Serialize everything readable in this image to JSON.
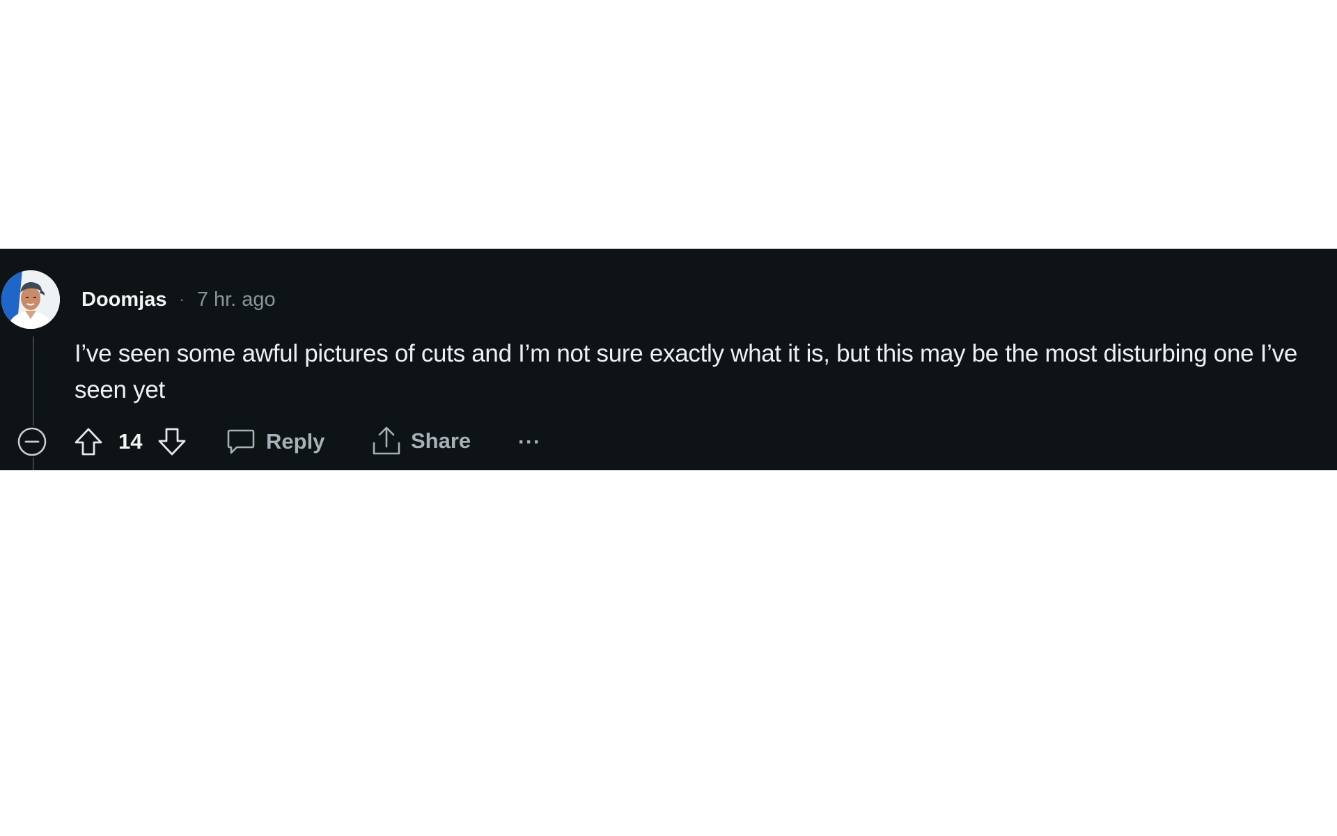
{
  "comment": {
    "username": "Doomjas",
    "separator": "·",
    "timestamp": "7 hr. ago",
    "body": "I’ve seen some awful pictures of cuts and I’m not sure exactly what it is, but this may be the most disturbing one I’ve seen yet",
    "score": "14",
    "reply_label": "Reply",
    "share_label": "Share",
    "more_label": "···",
    "avatar": "user-avatar-photo"
  },
  "icons": {
    "collapse": "collapse-circle-minus-icon",
    "upvote": "upvote-arrow-icon",
    "downvote": "downvote-arrow-icon",
    "reply": "speech-bubble-icon",
    "share": "share-upload-icon",
    "more": "ellipsis-icon"
  },
  "colors": {
    "background": "#0e1416",
    "text": "#eef1f3",
    "muted": "#a8b1b7",
    "page": "#ffffff"
  }
}
